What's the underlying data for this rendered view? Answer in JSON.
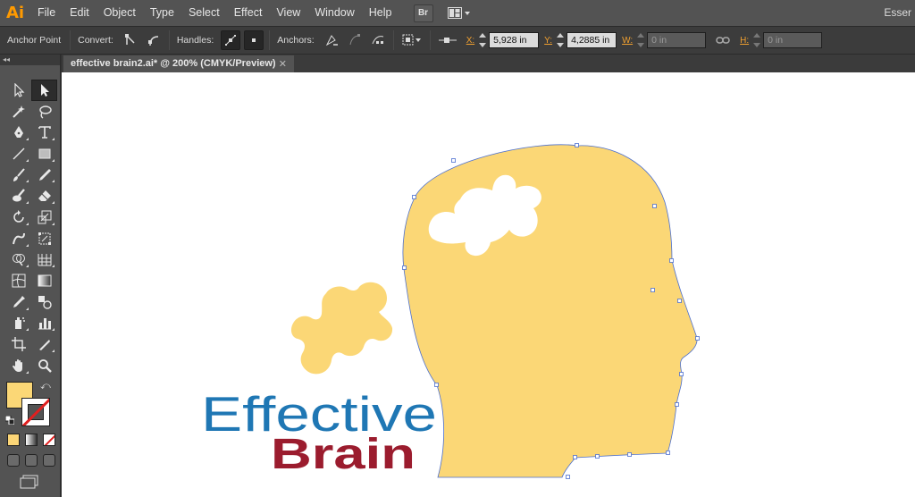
{
  "app": {
    "logo": "Ai"
  },
  "menu": [
    "File",
    "Edit",
    "Object",
    "Type",
    "Select",
    "Effect",
    "View",
    "Window",
    "Help"
  ],
  "menubar_buttons": {
    "bridge": "Br"
  },
  "workspace": "Esser",
  "controlbar": {
    "tool_name": "Anchor Point",
    "convert_label": "Convert:",
    "handles_label": "Handles:",
    "anchors_label": "Anchors:",
    "x_label": "X:",
    "x_value": "5,928 in",
    "y_label": "Y:",
    "y_value": "4,2885 in",
    "w_label": "W:",
    "w_value": "0 in",
    "h_label": "H:",
    "h_value": "0 in"
  },
  "panel_grip": "◂◂",
  "document_tab": {
    "title": "effective brain2.ai* @ 200% (CMYK/Preview)",
    "close": "✕"
  },
  "artwork": {
    "word1": "Effective",
    "word2": "Brain",
    "fill_color": "#FBD776",
    "blue_color": "#1F77B4",
    "red_color": "#9B1C2E",
    "selection_color": "#4B6FD0"
  },
  "tools": [
    "selection-icon",
    "direct-selection-icon",
    "magic-wand-icon",
    "lasso-icon",
    "pen-icon",
    "type-icon",
    "line-segment-icon",
    "rectangle-icon",
    "paintbrush-icon",
    "pencil-icon",
    "blob-brush-icon",
    "eraser-icon",
    "rotate-icon",
    "scale-icon",
    "warp-icon",
    "free-transform-icon",
    "shape-builder-icon",
    "perspective-grid-icon",
    "mesh-icon",
    "gradient-icon",
    "eyedropper-icon",
    "blend-icon",
    "symbol-sprayer-icon",
    "column-graph-icon",
    "artboard-icon",
    "slice-icon",
    "hand-icon",
    "zoom-icon"
  ]
}
